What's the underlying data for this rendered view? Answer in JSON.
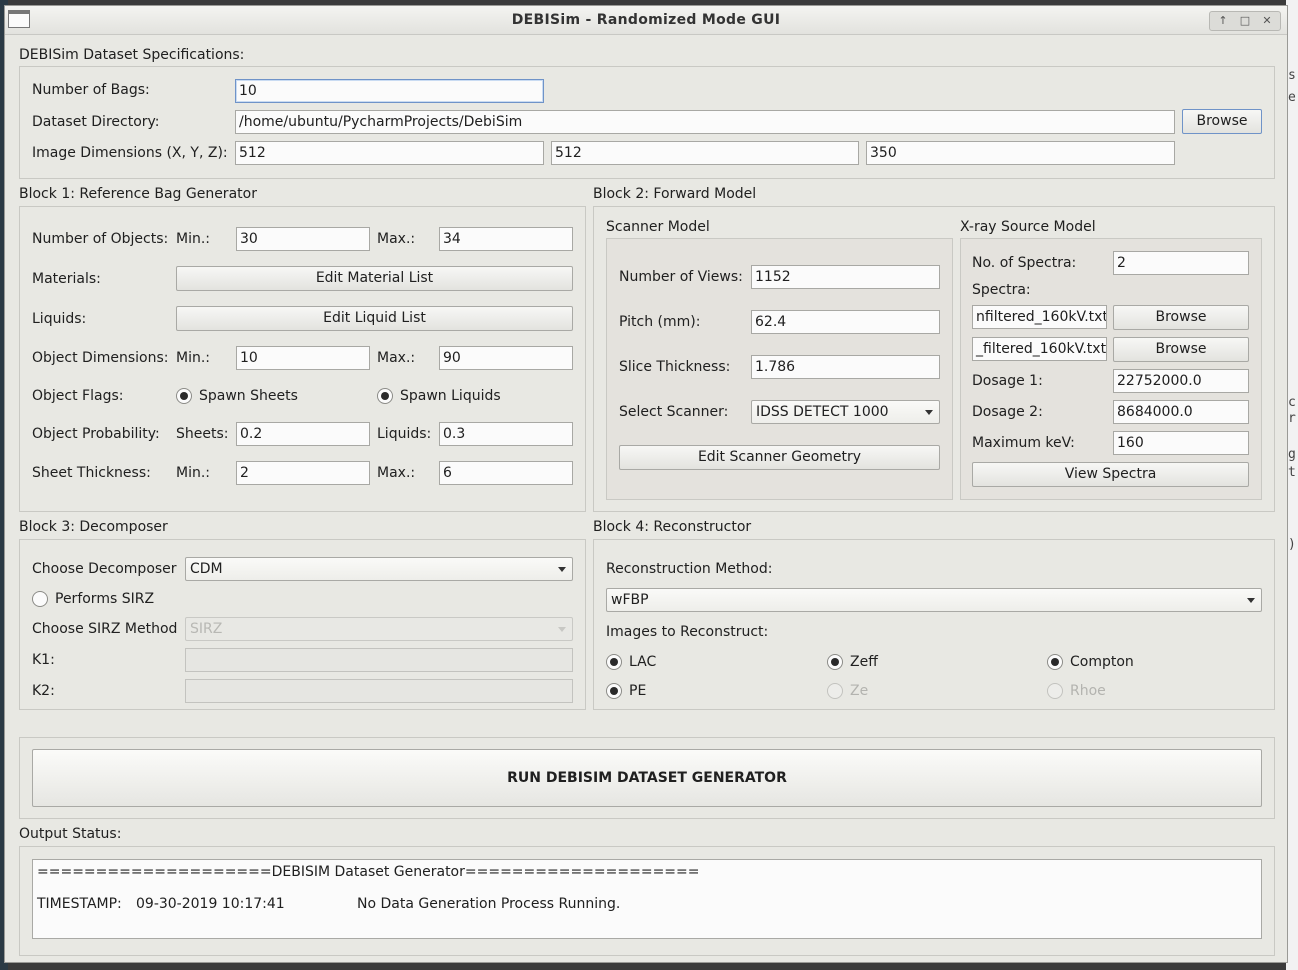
{
  "window": {
    "title": "DEBISim - Randomized Mode GUI",
    "controls": [
      "↑",
      "□",
      "✕"
    ]
  },
  "desktop_edge": [
    "s",
    "e",
    "c",
    "r",
    "g",
    "t",
    ")"
  ],
  "dataset": {
    "section": "DEBISim Dataset Specifications:",
    "num_bags_label": "Number of Bags:",
    "num_bags": "10",
    "dir_label": "Dataset Directory:",
    "dir": "/home/ubuntu/PycharmProjects/DebiSim",
    "browse": "Browse",
    "dims_label": "Image Dimensions (X, Y, Z):",
    "dim_x": "512",
    "dim_y": "512",
    "dim_z": "350"
  },
  "block1": {
    "title": "Block 1: Reference Bag Generator",
    "num_objects": "Number of Objects:",
    "min": "Min.:",
    "max": "Max.:",
    "obj_min": "30",
    "obj_max": "34",
    "materials": "Materials:",
    "edit_materials": "Edit Material List",
    "liquids": "Liquids:",
    "edit_liquids": "Edit Liquid List",
    "obj_dims": "Object Dimensions:",
    "dim_min": "10",
    "dim_max": "90",
    "flags": "Object Flags:",
    "spawn_sheets": "Spawn Sheets",
    "spawn_liquids": "Spawn Liquids",
    "probability": "Object Probability:",
    "sheets": "Sheets:",
    "sheets_val": "0.2",
    "liquids_short": "Liquids:",
    "liquids_val": "0.3",
    "sheet_thickness": "Sheet Thickness:",
    "th_min": "2",
    "th_max": "6"
  },
  "block2": {
    "title": "Block 2: Forward Model",
    "scanner": {
      "title": "Scanner Model",
      "views_label": "Number of Views:",
      "views": "1152",
      "pitch_label": "Pitch (mm):",
      "pitch": "62.4",
      "slice_label": "Slice Thickness:",
      "slice": "1.786",
      "select_label": "Select Scanner:",
      "select": "IDSS DETECT 1000",
      "edit_geometry": "Edit Scanner Geometry"
    },
    "xray": {
      "title": "X-ray Source Model",
      "num_spectra_label": "No. of Spectra:",
      "num_spectra": "2",
      "spectra_label": "Spectra:",
      "spectra1": "nfiltered_160kV.txt",
      "spectra2": "_filtered_160kV.txt",
      "browse": "Browse",
      "dosage1_label": "Dosage 1:",
      "dosage1": "22752000.0",
      "dosage2_label": "Dosage 2:",
      "dosage2": "8684000.0",
      "kev_label": "Maximum keV:",
      "kev": "160",
      "view_spectra": "View Spectra"
    }
  },
  "block3": {
    "title": "Block 3: Decomposer",
    "choose_label": "Choose Decomposer",
    "choose": "CDM",
    "sirz": "Performs SIRZ",
    "sirz_method_label": "Choose SIRZ Method",
    "sirz_method": "SIRZ",
    "k1": "K1:",
    "k2": "K2:"
  },
  "block4": {
    "title": "Block 4: Reconstructor",
    "method_label": "Reconstruction Method:",
    "method": "wFBP",
    "images_label": "Images to Reconstruct:",
    "lac": "LAC",
    "zeff": "Zeff",
    "compton": "Compton",
    "pe": "PE",
    "ze": "Ze",
    "rhoe": "Rhoe"
  },
  "run": {
    "label": "RUN DEBISIM DATASET GENERATOR"
  },
  "output": {
    "title": "Output Status:",
    "banner": "====================DEBISIM Dataset Generator====================",
    "timestamp_label": "TIMESTAMP:",
    "timestamp": "09-30-2019 10:17:41",
    "status": "No Data Generation Process Running."
  }
}
